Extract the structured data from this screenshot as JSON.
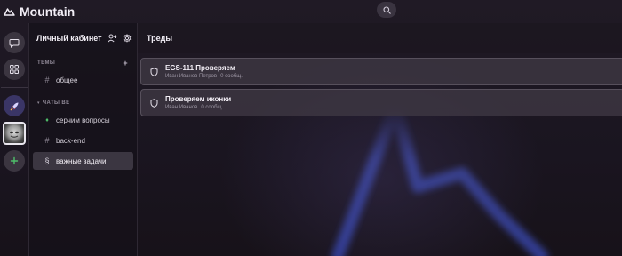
{
  "app": {
    "name": "Mountain"
  },
  "icons": {
    "logo": "mountain-logo-icon",
    "search": "search-icon",
    "chat": "chat-bubble-icon",
    "apps": "grid-icon",
    "rocket": "rocket-icon",
    "avatar": "avatar",
    "add": "plus-icon",
    "add_user": "add-user-icon",
    "settings": "gear-icon",
    "shield": "shield-icon"
  },
  "colors": {
    "accent_blue": "#4a5bd4",
    "add_green": "#4fbf6a"
  },
  "sidebar": {
    "title": "Личный кабинет",
    "topics_label": "ТЕМЫ",
    "topics_add": "+",
    "topics": [
      {
        "glyph": "#",
        "label": "общее"
      }
    ],
    "chats_label": "ЧАТЫ BE",
    "chats_prefix": "▾",
    "chats": [
      {
        "glyph": "♦",
        "label": "серчим вопросы"
      },
      {
        "glyph": "#",
        "label": "back-end"
      },
      {
        "glyph": "§",
        "label": "важные задачи",
        "active": true
      }
    ]
  },
  "main": {
    "title": "Треды",
    "threads": [
      {
        "title": "EGS-111 Проверяем",
        "author": "Иван Иванов Петров",
        "messages": "0 сообщ."
      },
      {
        "title": "Проверяем иконки",
        "author": "Иван Иванов",
        "messages": "0 сообщ."
      }
    ]
  }
}
